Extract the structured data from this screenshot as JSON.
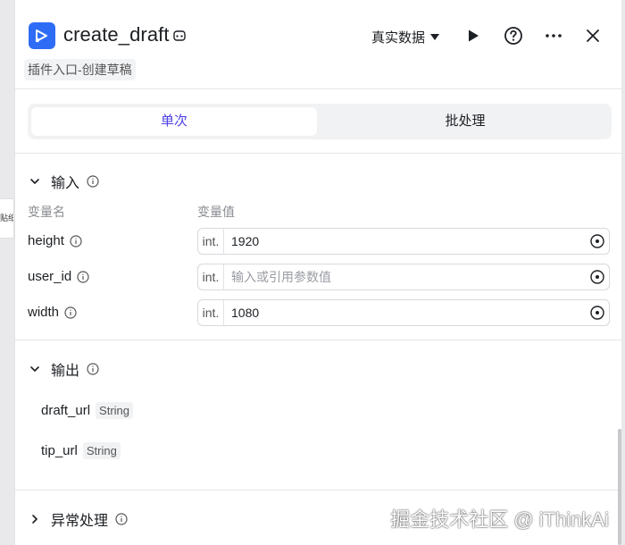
{
  "background": {
    "side_text": "贴纸"
  },
  "header": {
    "title": "create_draft",
    "subtitle": "插件入口-创建草稿",
    "data_mode": "真实数据"
  },
  "tabs": [
    {
      "label": "单次",
      "active": true
    },
    {
      "label": "批处理",
      "active": false
    }
  ],
  "input_section": {
    "title": "输入",
    "col_name": "变量名",
    "col_value": "变量值",
    "params": [
      {
        "name": "height",
        "type": "int.",
        "value": "1920",
        "placeholder": ""
      },
      {
        "name": "user_id",
        "type": "int.",
        "value": "",
        "placeholder": "输入或引用参数值"
      },
      {
        "name": "width",
        "type": "int.",
        "value": "1080",
        "placeholder": ""
      }
    ]
  },
  "output_section": {
    "title": "输出",
    "outputs": [
      {
        "name": "draft_url",
        "type": "String"
      },
      {
        "name": "tip_url",
        "type": "String"
      }
    ]
  },
  "exception_section": {
    "title": "异常处理"
  },
  "watermark": "掘金技术社区 @ iThinkAi",
  "colors": {
    "accent": "#4e40e5",
    "brand": "#2f6cf6"
  }
}
